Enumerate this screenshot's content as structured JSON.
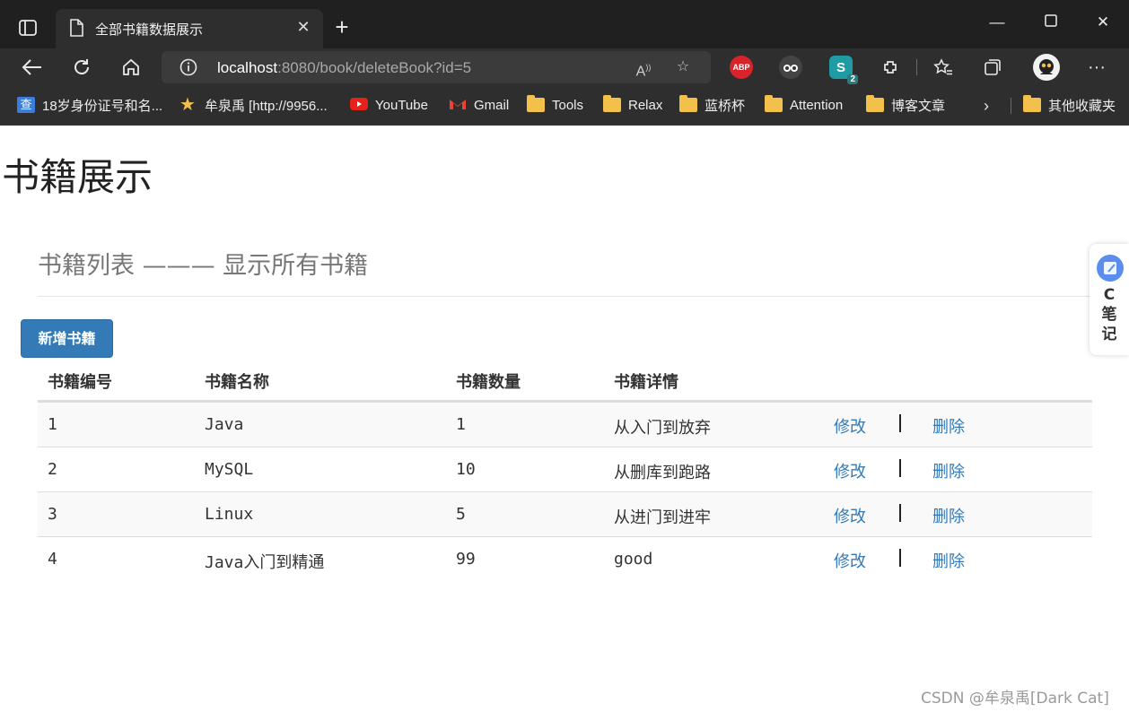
{
  "browser": {
    "tab_title": "全部书籍数据展示",
    "url_host": "localhost",
    "url_rest": ":8080/book/deleteBook?id=5",
    "extensions": {
      "abp": "ABP",
      "badge": "2"
    }
  },
  "bookmarks": [
    {
      "label": "18岁身份证号和名...",
      "icon": "query-icon"
    },
    {
      "label": "牟泉禹 [http://9956...",
      "icon": "star-icon"
    },
    {
      "label": "YouTube",
      "icon": "youtube-icon"
    },
    {
      "label": "Gmail",
      "icon": "gmail-icon"
    },
    {
      "label": "Tools",
      "icon": "folder-icon"
    },
    {
      "label": "Relax",
      "icon": "folder-icon"
    },
    {
      "label": "蓝桥杯",
      "icon": "folder-icon"
    },
    {
      "label": "Attention",
      "icon": "folder-icon"
    },
    {
      "label": "博客文章",
      "icon": "folder-icon"
    },
    {
      "label": "其他收藏夹",
      "icon": "folder-icon"
    }
  ],
  "page": {
    "heading": "书籍展示",
    "subtitle": "书籍列表 ——— 显示所有书籍",
    "add_button": "新增书籍",
    "columns": [
      "书籍编号",
      "书籍名称",
      "书籍数量",
      "书籍详情"
    ],
    "rows": [
      {
        "id": "1",
        "name": "Java",
        "count": "1",
        "detail": "从入门到放弃"
      },
      {
        "id": "2",
        "name": "MySQL",
        "count": "10",
        "detail": "从删库到跑路"
      },
      {
        "id": "3",
        "name": "Linux",
        "count": "5",
        "detail": "从进门到进牢"
      },
      {
        "id": "4",
        "name": "Java入门到精通",
        "count": "99",
        "detail": "good"
      }
    ],
    "edit_label": "修改",
    "delete_label": "删除"
  },
  "side_note": {
    "label": "C笔记"
  },
  "watermark": "CSDN @牟泉禹[Dark Cat]",
  "colors": {
    "link": "#337ab7",
    "primary_button": "#337ab7"
  }
}
